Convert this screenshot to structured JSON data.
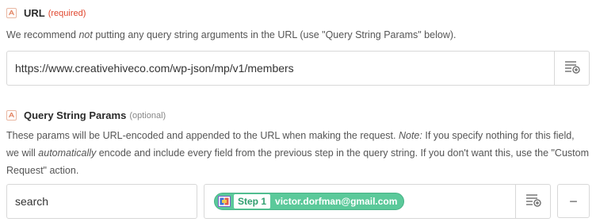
{
  "url_field": {
    "title": "URL",
    "badge": "(required)",
    "help_before": "We recommend ",
    "help_em": "not",
    "help_after": " putting any query string arguments in the URL (use \"Query String Params\" below).",
    "value": "https://www.creativehiveco.com/wp-json/mp/v1/members",
    "insert_icon": "insert-field-icon"
  },
  "query_params": {
    "title": "Query String Params",
    "badge": "(optional)",
    "help_1": "These params will be URL-encoded and appended to the URL when making the request. ",
    "help_note": "Note:",
    "help_2": " If you specify nothing for this field, we will ",
    "help_auto": "automatically",
    "help_3": " encode and include every field from the previous step in the query string. If you don't want this, use the \"Custom Request\" action.",
    "rows": [
      {
        "key": "search",
        "step_label": "Step 1",
        "value": "victor.dorfman@gmail.com"
      }
    ],
    "remove_label": "−"
  },
  "colors": {
    "required": "#e0462d",
    "pill": "#5bc99a",
    "border": "#d8d8d8"
  }
}
